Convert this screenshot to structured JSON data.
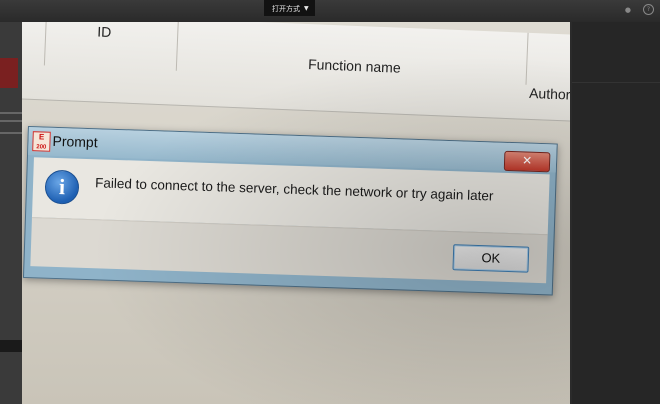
{
  "viewer": {
    "open_with_label": "打开方式"
  },
  "grid": {
    "columns": [
      "ID",
      "Function name",
      "Author"
    ]
  },
  "dialog": {
    "title": "Prompt",
    "message": "Failed to connect to the server, check the network or try again later",
    "ok_label": "OK",
    "close_label": "✕",
    "icon": "info-icon",
    "app_icon_text": "E\n200"
  },
  "colors": {
    "titlebar": "#97b9cd",
    "close_button": "#c1392b",
    "info_icon": "#1d5fb2"
  }
}
